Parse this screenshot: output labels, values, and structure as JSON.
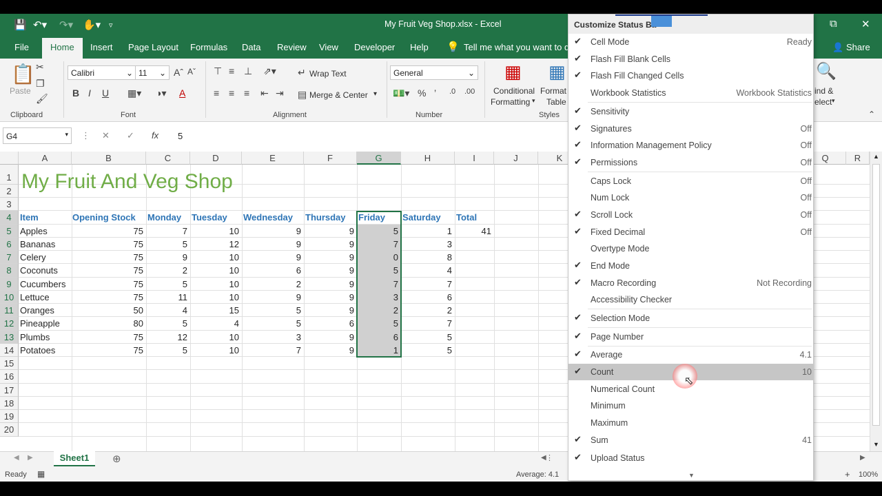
{
  "titlebar": {
    "filename": "My Fruit Veg Shop.xlsx  -  Excel",
    "qa_icons": [
      "save-icon",
      "undo-icon",
      "redo-icon",
      "touch-mode-icon",
      "customize-qa-icon"
    ]
  },
  "tabs": [
    "File",
    "Home",
    "Insert",
    "Page Layout",
    "Formulas",
    "Data",
    "Review",
    "View",
    "Developer",
    "Help"
  ],
  "tell_me": "Tell me what you want to do",
  "share": "Share",
  "ribbon": {
    "clipboard": {
      "paste": "Paste",
      "label": "Clipboard"
    },
    "font": {
      "name": "Calibri",
      "size": "11",
      "label": "Font",
      "bold": "B",
      "italic": "I",
      "underline": "U"
    },
    "alignment": {
      "wrap": "Wrap Text",
      "merge": "Merge & Center",
      "label": "Alignment"
    },
    "number": {
      "format": "General",
      "label": "Number"
    },
    "styles": {
      "cond": "Conditional",
      "formatting": "Formatting",
      "format_as": "Format",
      "table": "Table",
      "label": "Styles"
    },
    "editing": {
      "find": "ind &",
      "select": "elect"
    }
  },
  "formula_bar": {
    "name_box": "G4",
    "value": "5"
  },
  "columns": [
    "A",
    "B",
    "C",
    "D",
    "E",
    "F",
    "G",
    "H",
    "I",
    "J",
    "K",
    "Q",
    "R"
  ],
  "rows": [
    "1",
    "2",
    "3",
    "4",
    "5",
    "6",
    "7",
    "8",
    "9",
    "10",
    "11",
    "12",
    "13",
    "14",
    "15",
    "16",
    "17",
    "18",
    "19",
    "20"
  ],
  "sheet_title": "My Fruit And Veg Shop",
  "table_headers": [
    "Item",
    "Opening Stock",
    "Monday",
    "Tuesday",
    "Wednesday",
    "Thursday",
    "Friday",
    "Saturday",
    "Total"
  ],
  "table_rows": [
    {
      "item": "Apples",
      "vals": [
        "75",
        "7",
        "10",
        "9",
        "9",
        "5",
        "1"
      ],
      "total": "41"
    },
    {
      "item": "Bananas",
      "vals": [
        "75",
        "5",
        "12",
        "9",
        "9",
        "7",
        "3"
      ],
      "total": ""
    },
    {
      "item": "Celery",
      "vals": [
        "75",
        "9",
        "10",
        "9",
        "9",
        "0",
        "8"
      ],
      "total": ""
    },
    {
      "item": "Coconuts",
      "vals": [
        "75",
        "2",
        "10",
        "6",
        "9",
        "5",
        "4"
      ],
      "total": ""
    },
    {
      "item": "Cucumbers",
      "vals": [
        "75",
        "5",
        "10",
        "2",
        "9",
        "7",
        "7"
      ],
      "total": ""
    },
    {
      "item": "Lettuce",
      "vals": [
        "75",
        "11",
        "10",
        "9",
        "9",
        "3",
        "6"
      ],
      "total": ""
    },
    {
      "item": "Oranges",
      "vals": [
        "50",
        "4",
        "15",
        "5",
        "9",
        "2",
        "2"
      ],
      "total": ""
    },
    {
      "item": "Pineapple",
      "vals": [
        "80",
        "5",
        "4",
        "5",
        "6",
        "5",
        "7"
      ],
      "total": ""
    },
    {
      "item": "Plumbs",
      "vals": [
        "75",
        "12",
        "10",
        "3",
        "9",
        "6",
        "5"
      ],
      "total": ""
    },
    {
      "item": "Potatoes",
      "vals": [
        "75",
        "5",
        "10",
        "7",
        "9",
        "1",
        "5"
      ],
      "total": ""
    }
  ],
  "sheet_tab": "Sheet1",
  "status": {
    "ready": "Ready",
    "average": "Average: 4.1",
    "zoom": "100%"
  },
  "menu": {
    "title": "Customize Status Ba",
    "items": [
      {
        "label": "Cell Mode",
        "checked": true,
        "value": "Ready"
      },
      {
        "label": "Flash Fill Blank Cells",
        "checked": true,
        "value": ""
      },
      {
        "label": "Flash Fill Changed Cells",
        "checked": true,
        "value": ""
      },
      {
        "label": "Workbook Statistics",
        "checked": false,
        "value": "Workbook Statistics"
      },
      {
        "label": "Sensitivity",
        "checked": true,
        "value": ""
      },
      {
        "label": "Signatures",
        "checked": true,
        "value": "Off"
      },
      {
        "label": "Information Management Policy",
        "checked": true,
        "value": "Off"
      },
      {
        "label": "Permissions",
        "checked": true,
        "value": "Off"
      },
      {
        "label": "Caps Lock",
        "checked": false,
        "value": "Off"
      },
      {
        "label": "Num Lock",
        "checked": false,
        "value": "Off"
      },
      {
        "label": "Scroll Lock",
        "checked": true,
        "value": "Off"
      },
      {
        "label": "Fixed Decimal",
        "checked": true,
        "value": "Off"
      },
      {
        "label": "Overtype Mode",
        "checked": false,
        "value": ""
      },
      {
        "label": "End Mode",
        "checked": true,
        "value": ""
      },
      {
        "label": "Macro Recording",
        "checked": true,
        "value": "Not Recording"
      },
      {
        "label": "Accessibility Checker",
        "checked": false,
        "value": ""
      },
      {
        "label": "Selection Mode",
        "checked": true,
        "value": ""
      },
      {
        "label": "Page Number",
        "checked": true,
        "value": ""
      },
      {
        "label": "Average",
        "checked": true,
        "value": "4.1"
      },
      {
        "label": "Count",
        "checked": true,
        "value": "10"
      },
      {
        "label": "Numerical Count",
        "checked": false,
        "value": ""
      },
      {
        "label": "Minimum",
        "checked": false,
        "value": ""
      },
      {
        "label": "Maximum",
        "checked": false,
        "value": ""
      },
      {
        "label": "Sum",
        "checked": true,
        "value": "41"
      },
      {
        "label": "Upload Status",
        "checked": true,
        "value": ""
      }
    ]
  },
  "colors": {
    "excel_green": "#217346",
    "title_green": "#70ad47",
    "header_blue": "#2e75b6"
  }
}
